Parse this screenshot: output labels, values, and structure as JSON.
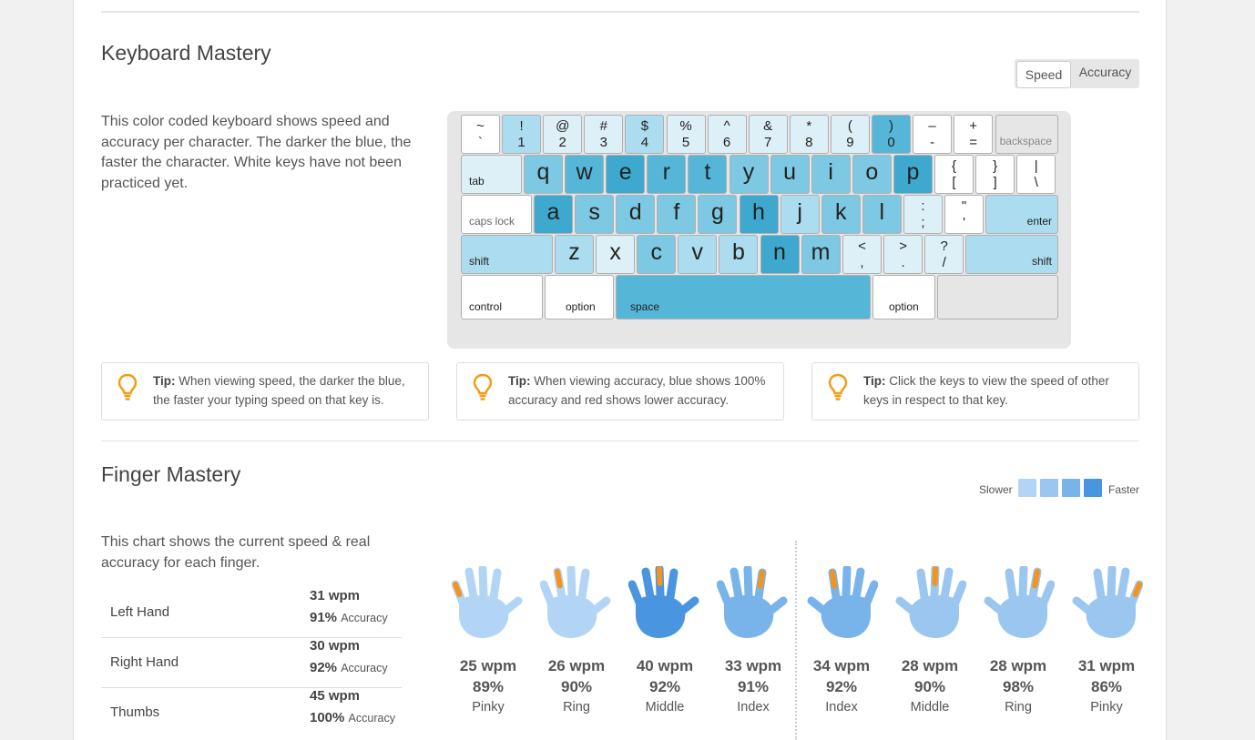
{
  "keyboard_section": {
    "title": "Keyboard Mastery",
    "description": "This color coded keyboard shows speed and accuracy per character. The darker the blue, the faster the character. White keys have not been practiced yet.",
    "toggle": {
      "active": "Speed",
      "inactive": "Accuracy"
    }
  },
  "colors": {
    "white": "#ffffff",
    "lightest": "#ddeff7",
    "light": "#abdcef",
    "mid_light": "#7dc8e2",
    "mid": "#55b6d8",
    "dark": "#3ea8cf",
    "darkest": "#2590bd",
    "gray_key": "#e6e6e6",
    "tip_orange": "#f39c12",
    "hand_lightest": "#b3d5f5",
    "hand_light": "#9ac6ef",
    "hand_mid": "#78b3ea",
    "hand_dark": "#4a95e0",
    "finger_orange": "#f3941f"
  },
  "keyboard": {
    "row1": [
      {
        "top": "~",
        "bot": "`",
        "shade": "white"
      },
      {
        "top": "!",
        "bot": "1",
        "shade": "light"
      },
      {
        "top": "@",
        "bot": "2",
        "shade": "lightest"
      },
      {
        "top": "#",
        "bot": "3",
        "shade": "lightest"
      },
      {
        "top": "$",
        "bot": "4",
        "shade": "light"
      },
      {
        "top": "%",
        "bot": "5",
        "shade": "lightest"
      },
      {
        "top": "^",
        "bot": "6",
        "shade": "lightest"
      },
      {
        "top": "&",
        "bot": "7",
        "shade": "lightest"
      },
      {
        "top": "*",
        "bot": "8",
        "shade": "lightest"
      },
      {
        "top": "(",
        "bot": "9",
        "shade": "lightest"
      },
      {
        "top": ")",
        "bot": "0",
        "shade": "mid"
      },
      {
        "top": "–",
        "bot": "-",
        "shade": "white"
      },
      {
        "top": "+",
        "bot": "=",
        "shade": "white"
      }
    ],
    "backspace": "backspace",
    "tab": "tab",
    "row2": [
      {
        "ch": "q",
        "shade": "mid_light"
      },
      {
        "ch": "w",
        "shade": "mid"
      },
      {
        "ch": "e",
        "shade": "dark"
      },
      {
        "ch": "r",
        "shade": "mid"
      },
      {
        "ch": "t",
        "shade": "mid"
      },
      {
        "ch": "y",
        "shade": "mid_light"
      },
      {
        "ch": "u",
        "shade": "mid_light"
      },
      {
        "ch": "i",
        "shade": "mid_light"
      },
      {
        "ch": "o",
        "shade": "mid_light"
      },
      {
        "ch": "p",
        "shade": "dark"
      }
    ],
    "row2_sym": [
      {
        "top": "{",
        "bot": "["
      },
      {
        "top": "}",
        "bot": "]"
      },
      {
        "top": "|",
        "bot": "\\"
      }
    ],
    "caps": "caps lock",
    "row3": [
      {
        "ch": "a",
        "shade": "dark"
      },
      {
        "ch": "s",
        "shade": "mid_light"
      },
      {
        "ch": "d",
        "shade": "mid_light"
      },
      {
        "ch": "f",
        "shade": "mid_light"
      },
      {
        "ch": "g",
        "shade": "mid_light"
      },
      {
        "ch": "h",
        "shade": "dark"
      },
      {
        "ch": "j",
        "shade": "light"
      },
      {
        "ch": "k",
        "shade": "mid_light"
      },
      {
        "ch": "l",
        "shade": "mid_light"
      }
    ],
    "row3_sym": [
      {
        "top": ":",
        "bot": ";",
        "shade": "lightest"
      },
      {
        "top": "\"",
        "bot": "'",
        "shade": "white"
      }
    ],
    "enter": "enter",
    "shift": "shift",
    "row4": [
      {
        "ch": "z",
        "shade": "light"
      },
      {
        "ch": "x",
        "shade": "lightest"
      },
      {
        "ch": "c",
        "shade": "mid_light"
      },
      {
        "ch": "v",
        "shade": "light"
      },
      {
        "ch": "b",
        "shade": "light"
      },
      {
        "ch": "n",
        "shade": "dark"
      },
      {
        "ch": "m",
        "shade": "mid_light"
      }
    ],
    "row4_sym": [
      {
        "top": "<",
        "bot": ",",
        "shade": "lightest"
      },
      {
        "top": ">",
        "bot": ".",
        "shade": "lightest"
      },
      {
        "top": "?",
        "bot": "/",
        "shade": "lightest"
      }
    ],
    "control": "control",
    "option": "option",
    "space": "space"
  },
  "tips": [
    {
      "label": "Tip:",
      "text": "When viewing speed, the darker the blue, the faster your typing speed on that key is."
    },
    {
      "label": "Tip:",
      "text": "When viewing accuracy, blue shows 100% accuracy and red shows lower accuracy."
    },
    {
      "label": "Tip:",
      "text": "Click the keys to view the speed of other keys in respect to that key."
    }
  ],
  "finger_section": {
    "title": "Finger Mastery",
    "description": "This chart shows the current speed & real accuracy for each finger.",
    "legend": {
      "slower": "Slower",
      "faster": "Faster"
    },
    "hands": [
      {
        "label": "Left Hand",
        "wpm": "31 wpm",
        "acc": "91%",
        "acc_word": "Accuracy"
      },
      {
        "label": "Right Hand",
        "wpm": "30 wpm",
        "acc": "92%",
        "acc_word": "Accuracy"
      },
      {
        "label": "Thumbs",
        "wpm": "45 wpm",
        "acc": "100%",
        "acc_word": "Accuracy"
      }
    ],
    "fingers": [
      {
        "wpm": "25 wpm",
        "acc": "89%",
        "name": "Pinky",
        "shade": "hand_lightest",
        "hand": "left",
        "hi": 0
      },
      {
        "wpm": "26 wpm",
        "acc": "90%",
        "name": "Ring",
        "shade": "hand_lightest",
        "hand": "left",
        "hi": 1
      },
      {
        "wpm": "40 wpm",
        "acc": "92%",
        "name": "Middle",
        "shade": "hand_dark",
        "hand": "left",
        "hi": 2
      },
      {
        "wpm": "33 wpm",
        "acc": "91%",
        "name": "Index",
        "shade": "hand_mid",
        "hand": "left",
        "hi": 3
      },
      {
        "wpm": "34 wpm",
        "acc": "92%",
        "name": "Index",
        "shade": "hand_mid",
        "hand": "right",
        "hi": 3
      },
      {
        "wpm": "28 wpm",
        "acc": "90%",
        "name": "Middle",
        "shade": "hand_light",
        "hand": "right",
        "hi": 2
      },
      {
        "wpm": "28 wpm",
        "acc": "98%",
        "name": "Ring",
        "shade": "hand_light",
        "hand": "right",
        "hi": 1
      },
      {
        "wpm": "31 wpm",
        "acc": "86%",
        "name": "Pinky",
        "shade": "hand_light",
        "hand": "right",
        "hi": 0
      }
    ]
  }
}
